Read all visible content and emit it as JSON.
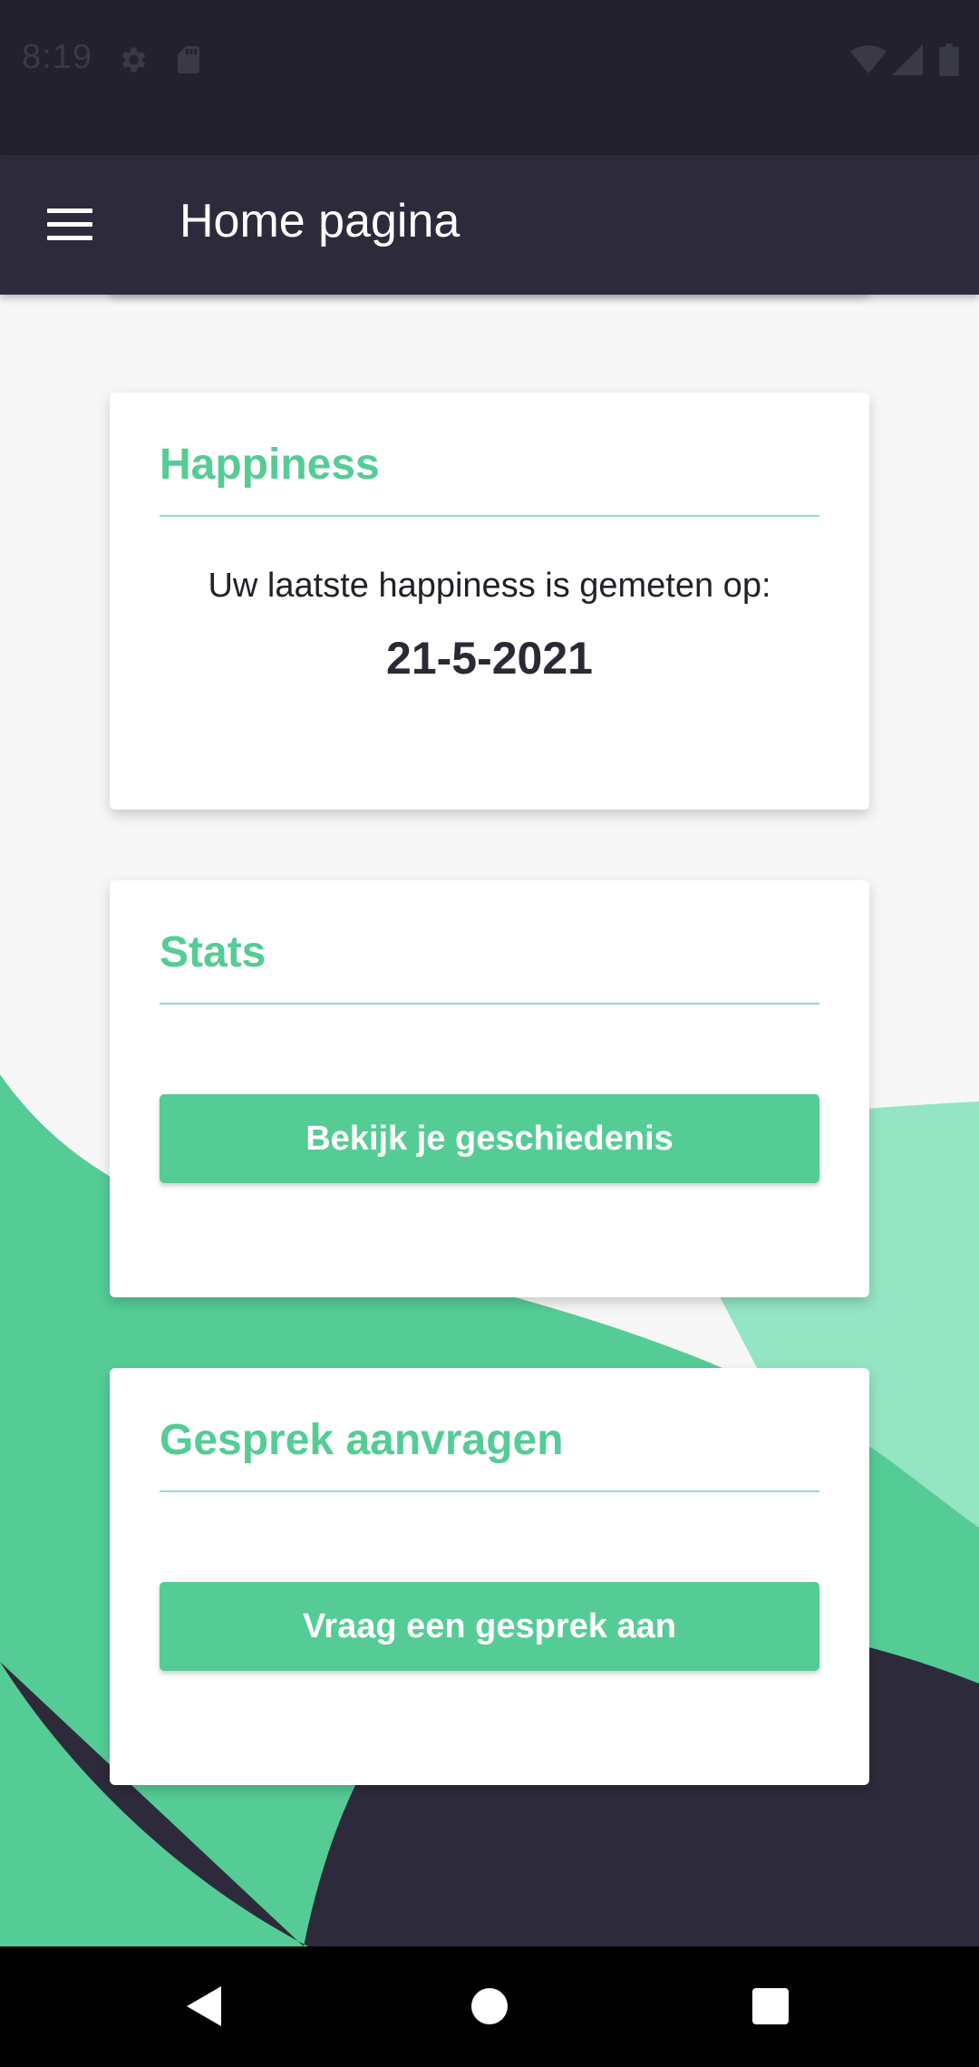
{
  "status_bar": {
    "time": "8:19",
    "icons_left": [
      "settings-icon",
      "sd-card-icon"
    ],
    "icons_right": [
      "wifi-icon",
      "signal-icon",
      "battery-icon"
    ]
  },
  "app_bar": {
    "title": "Home pagina",
    "menu_icon": "menu-icon"
  },
  "cards": {
    "happiness": {
      "title": "Happiness",
      "text": "Uw laatste happiness is gemeten op:",
      "date": "21-5-2021"
    },
    "stats": {
      "title": "Stats",
      "button_label": "Bekijk je geschiedenis"
    },
    "gesprek": {
      "title": "Gesprek aanvragen",
      "button_label": "Vraag een gesprek aan"
    }
  },
  "nav_bar": {
    "buttons": [
      "back-icon",
      "home-icon",
      "recents-icon"
    ]
  },
  "colors": {
    "accent": "#55cc95",
    "accent_light": "#8fe0bb",
    "dark": "#2d2b3b",
    "status_bar": "#22212d",
    "background": "#f7f7f7"
  }
}
